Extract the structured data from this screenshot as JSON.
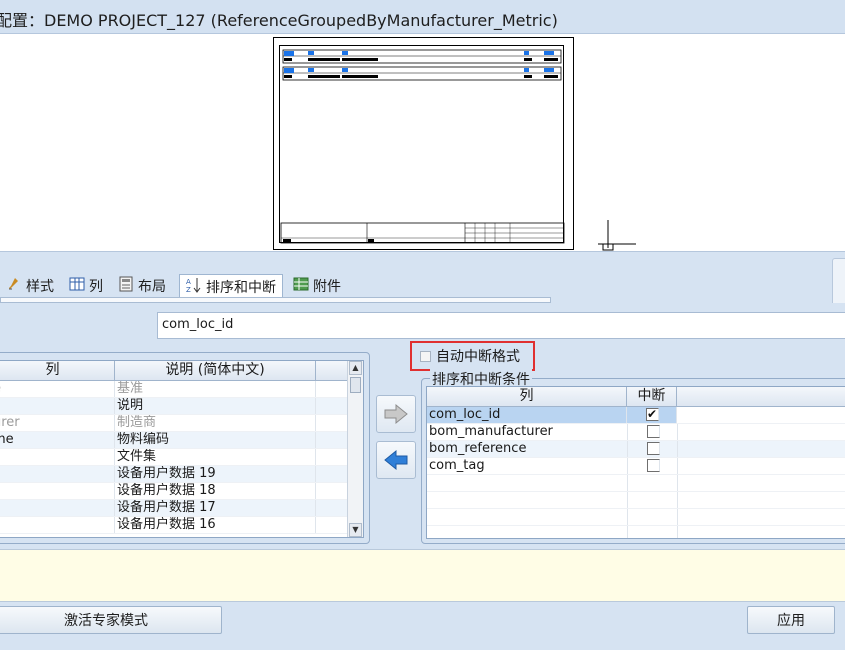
{
  "window": {
    "title": "配置：DEMO PROJECT_127 (ReferenceGroupedByManufacturer_Metric)"
  },
  "tabs": [
    {
      "label": "样式",
      "icon": "style-icon"
    },
    {
      "label": "列",
      "icon": "columns-icon"
    },
    {
      "label": "布局",
      "icon": "layout-icon"
    },
    {
      "label": "排序和中断",
      "icon": "sort-icon",
      "active": true
    },
    {
      "label": "附件",
      "icon": "attachment-icon"
    }
  ],
  "break_field": {
    "value": "com_loc_id"
  },
  "available_columns": {
    "headers": [
      "列",
      "说明 (简体中文)"
    ],
    "rows": [
      {
        "col": "e",
        "desc": "基准",
        "dim": true
      },
      {
        "col": "",
        "desc": "说明",
        "dim": false
      },
      {
        "col": "urer",
        "desc": "制造商",
        "dim": true
      },
      {
        "col": "me",
        "desc": "物料编码",
        "dim": false
      },
      {
        "col": "",
        "desc": "文件集",
        "dim": false
      },
      {
        "col": "",
        "desc": "设备用户数据 19",
        "dim": false
      },
      {
        "col": "",
        "desc": "设备用户数据 18",
        "dim": false
      },
      {
        "col": "",
        "desc": "设备用户数据 17",
        "dim": false
      },
      {
        "col": "",
        "desc": "设备用户数据 16",
        "dim": false
      }
    ]
  },
  "auto_break": {
    "label": "自动中断格式",
    "checked": false
  },
  "sort_conditions": {
    "legend": "排序和中断条件",
    "headers": [
      "列",
      "中断"
    ],
    "rows": [
      {
        "col": "com_loc_id",
        "break": true
      },
      {
        "col": "bom_manufacturer",
        "break": false
      },
      {
        "col": "bom_reference",
        "break": false
      },
      {
        "col": "com_tag",
        "break": false
      }
    ]
  },
  "footer": {
    "expert_button": "激活专家模式",
    "apply_button": "应用"
  }
}
